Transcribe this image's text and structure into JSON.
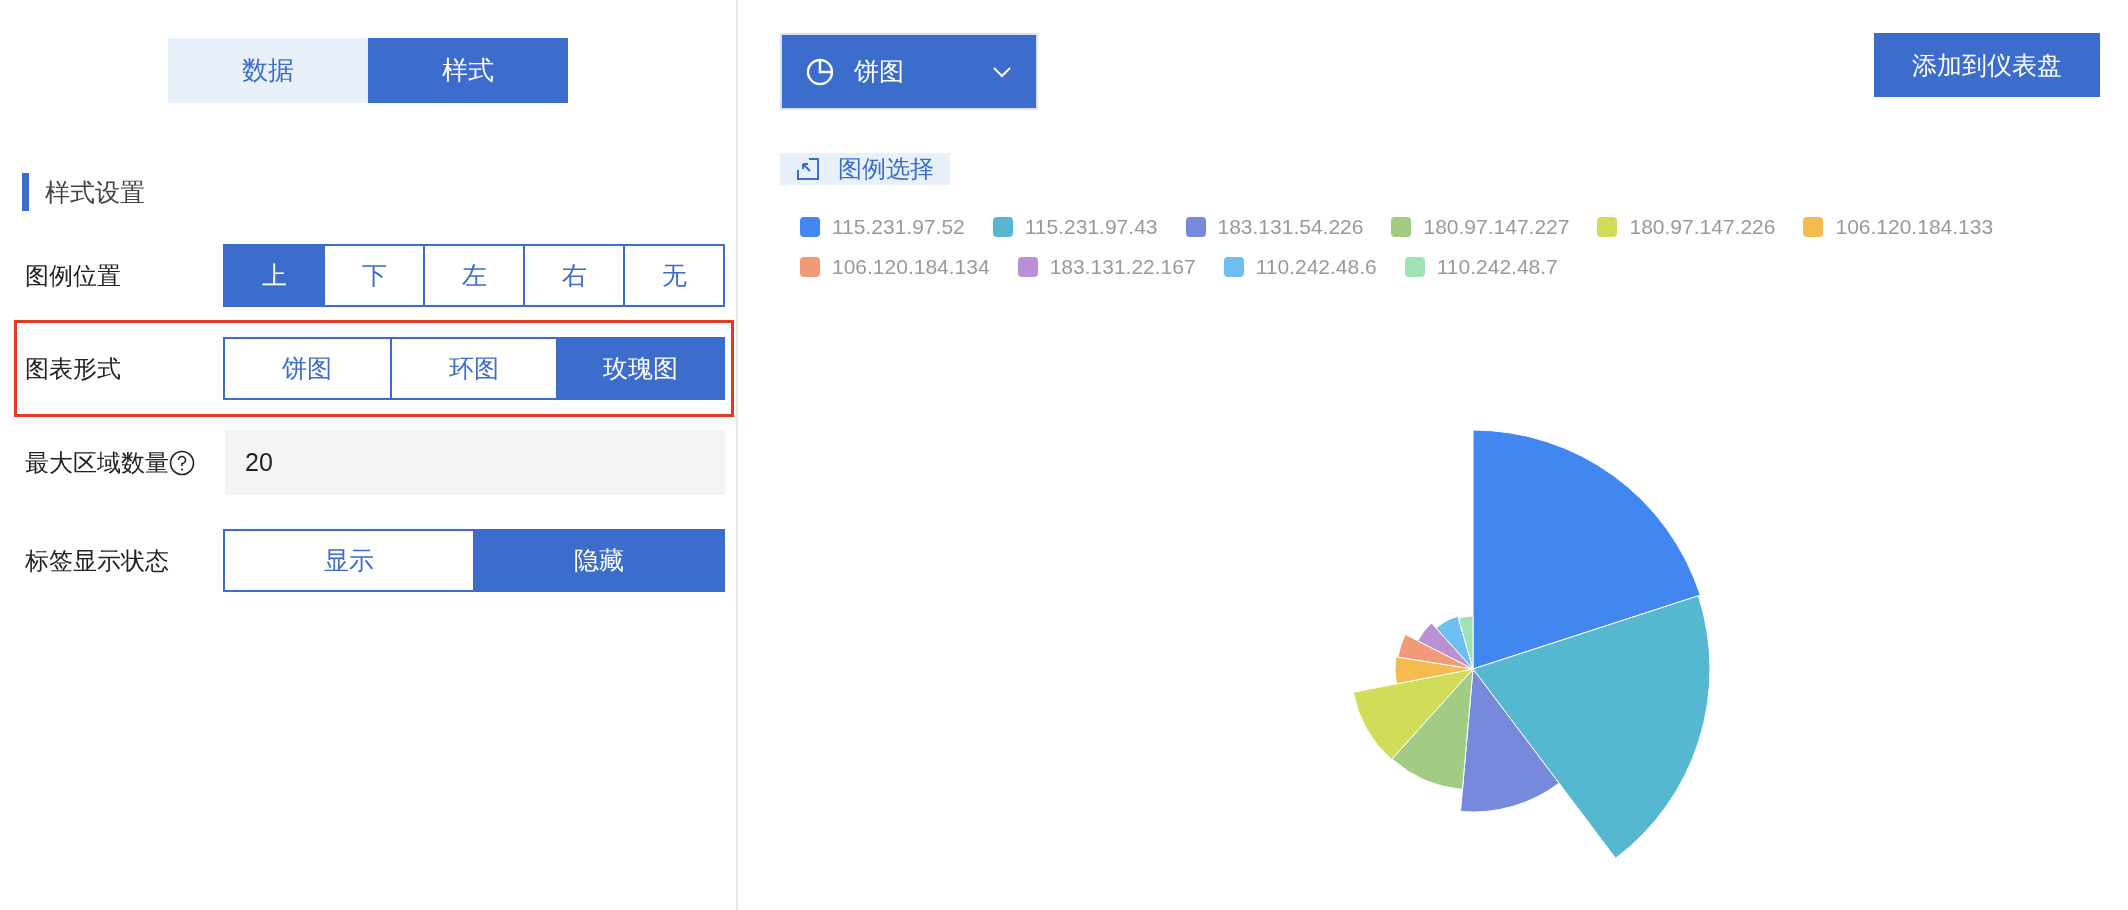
{
  "tabs": [
    {
      "label": "数据",
      "selected": false
    },
    {
      "label": "样式",
      "selected": true
    }
  ],
  "section_title": "样式设置",
  "settings": [
    {
      "kind": "segmented",
      "label": "图例位置",
      "highlighted": false,
      "options": [
        {
          "label": "上",
          "selected": true
        },
        {
          "label": "下",
          "selected": false
        },
        {
          "label": "左",
          "selected": false
        },
        {
          "label": "右",
          "selected": false
        },
        {
          "label": "无",
          "selected": false
        }
      ]
    },
    {
      "kind": "segmented",
      "label": "图表形式",
      "highlighted": true,
      "options": [
        {
          "label": "饼图",
          "selected": false
        },
        {
          "label": "环图",
          "selected": false
        },
        {
          "label": "玫瑰图",
          "selected": true
        }
      ]
    },
    {
      "kind": "input",
      "label": "最大区域数量",
      "value": "20"
    },
    {
      "kind": "segmented",
      "label": "标签显示状态",
      "highlighted": false,
      "options": [
        {
          "label": "显示",
          "selected": false
        },
        {
          "label": "隐藏",
          "selected": true
        }
      ]
    }
  ],
  "chart_type_dropdown": {
    "label": "饼图"
  },
  "add_button": "添加到仪表盘",
  "legend_select_button": "图例选择",
  "legend": [
    {
      "label": "115.231.97.52",
      "color": "#4287ef"
    },
    {
      "label": "115.231.97.43",
      "color": "#56b8d0"
    },
    {
      "label": "183.131.54.226",
      "color": "#7689db"
    },
    {
      "label": "180.97.147.227",
      "color": "#a2cc84"
    },
    {
      "label": "180.97.147.226",
      "color": "#d1dc59"
    },
    {
      "label": "106.120.184.133",
      "color": "#f4bc4f"
    },
    {
      "label": "106.120.184.134",
      "color": "#f09a78"
    },
    {
      "label": "183.131.22.167",
      "color": "#ba91d4"
    },
    {
      "label": "110.242.48.6",
      "color": "#6dbff0"
    },
    {
      "label": "110.242.48.7",
      "color": "#a0e2b6"
    }
  ]
}
